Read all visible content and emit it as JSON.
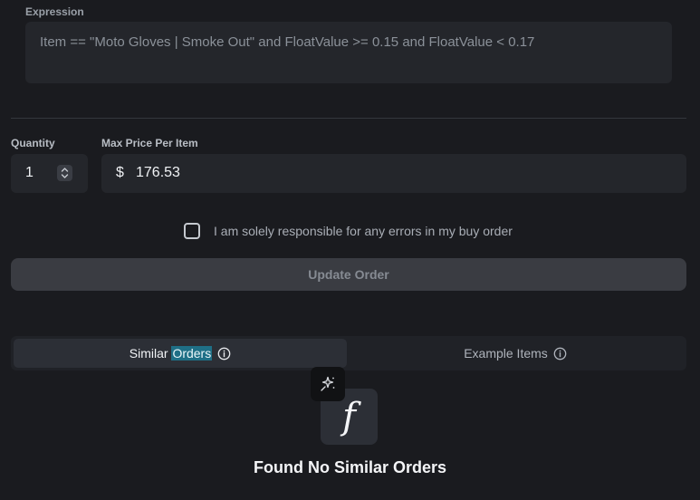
{
  "expression": {
    "label": "Expression",
    "value": "Item == \"Moto Gloves | Smoke Out\" and FloatValue >= 0.15 and FloatValue < 0.17"
  },
  "quantity": {
    "label": "Quantity",
    "value": "1"
  },
  "price": {
    "label": "Max Price Per Item",
    "currency_symbol": "$",
    "value": "176.53"
  },
  "agreement": {
    "label": "I am solely responsible for any errors in my buy order",
    "checked": false
  },
  "update_button": {
    "label": "Update Order"
  },
  "tabs": [
    {
      "label_prefix": "Similar ",
      "label_highlight": "Orders",
      "active": true,
      "icon": "info-icon"
    },
    {
      "label": "Example Items",
      "active": false,
      "icon": "info-icon"
    }
  ],
  "empty_state": {
    "icon_glyph": "f",
    "title": "Found No Similar Orders"
  },
  "colors": {
    "background": "#1a1b1f",
    "surface": "#24262b",
    "highlight": "#1f6f86"
  }
}
